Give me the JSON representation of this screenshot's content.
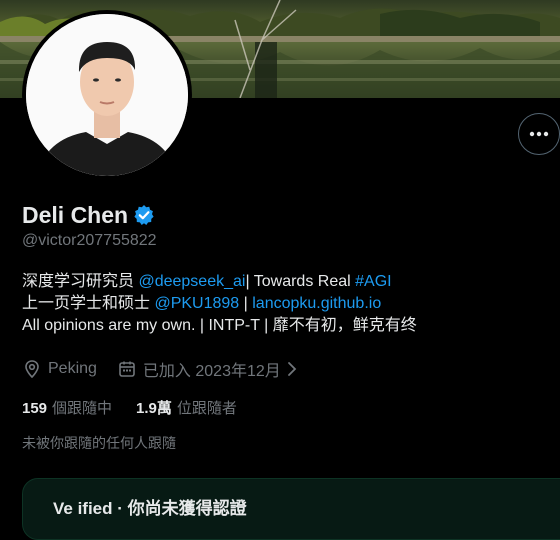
{
  "profile": {
    "display_name": "Deli Chen",
    "handle": "@victor207755822",
    "verified_icon": "verified-badge-icon",
    "more_icon": "more-horizontal-icon"
  },
  "bio": {
    "line1_text": "深度学习研究员 ",
    "line1_link": "@deepseek_ai",
    "line1_middle": "| Towards Real ",
    "line1_hashtag": "#AGI",
    "line2_text": "上一页学士和硕士 ",
    "line2_link1": "@PKU1898",
    "line2_sep": " | ",
    "line2_link2": "lancopku.github.io",
    "line3_text": "All opinions are my own. | INTP-T | 靡不有初，鲜克有终"
  },
  "meta": {
    "location": "Peking",
    "joined": "已加入 2023年12月",
    "location_icon": "location-pin-icon",
    "calendar_icon": "calendar-icon",
    "chevron_icon": "chevron-right-icon"
  },
  "stats": {
    "following_count": "159",
    "following_label": "個跟隨中",
    "followers_count": "1.9萬",
    "followers_label": "位跟隨者"
  },
  "not_followed_text": "未被你跟隨的任何人跟隨",
  "card": {
    "text": "Ve  ified  · 你尚未獲得認證"
  },
  "colors": {
    "background": "#000000",
    "text": "#e7e9ea",
    "secondary": "#71767b",
    "link": "#1d9bf0"
  }
}
